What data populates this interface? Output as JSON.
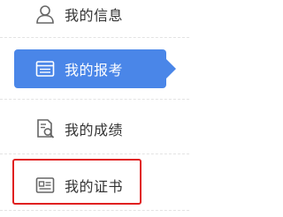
{
  "menu": {
    "items": [
      {
        "label": "我的信息",
        "icon": "user-icon",
        "active": false
      },
      {
        "label": "我的报考",
        "icon": "application-form-icon",
        "active": true
      },
      {
        "label": "我的成绩",
        "icon": "score-report-icon",
        "active": false
      },
      {
        "label": "我的证书",
        "icon": "certificate-icon",
        "active": false
      }
    ]
  },
  "colors": {
    "active_bg": "#4a86e8",
    "text": "#333333",
    "icon": "#666666",
    "highlight_border": "#e02020",
    "divider": "#e3e3e3"
  }
}
